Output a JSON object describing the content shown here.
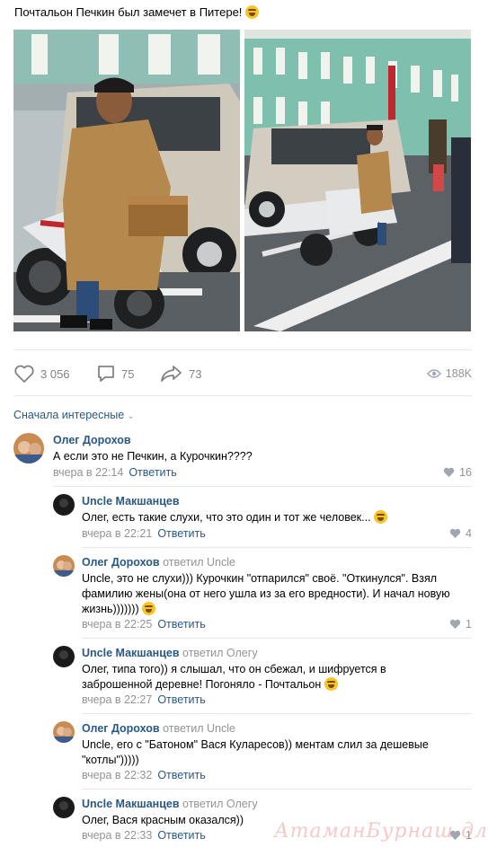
{
  "post": {
    "text": "Почтальон Печкин был замечет в Питере!",
    "emoji": "grinning-face-emoji"
  },
  "actions": {
    "likes": "3 056",
    "comments": "75",
    "shares": "73",
    "views": "188K"
  },
  "comments_sort": "Сначала интересные",
  "comments": [
    {
      "author": "Олег Дорохов",
      "replied_to": "",
      "text": "А если это не Печкин, а Курочкин????",
      "time": "вчера в 22:14",
      "reply_label": "Ответить",
      "likes": "16"
    },
    {
      "author": "Uncle Макшанцев",
      "replied_to": "",
      "text": "Олег, есть такие слухи, что это один и тот же человек...",
      "time": "вчера в 22:21",
      "reply_label": "Ответить",
      "likes": "4"
    },
    {
      "author": "Олег Дорохов",
      "replied_to": "ответил Uncle",
      "text": "Uncle, это не слухи))) Курочкин \"отпарился\" своё. \"Откинулся\". Взял фамилию жены(она от него ушла из за его вредности). И начал новую жизнь)))))))",
      "time": "вчера в 22:25",
      "reply_label": "Ответить",
      "likes": "1"
    },
    {
      "author": "Uncle Макшанцев",
      "replied_to": "ответил Олегу",
      "text": "Олег, типа того)) я слышал, что он сбежал, и шифруется в заброшенной деревне! Погоняло - Почтальон",
      "time": "вчера в 22:27",
      "reply_label": "Ответить",
      "likes": ""
    },
    {
      "author": "Олег Дорохов",
      "replied_to": "ответил Uncle",
      "text": "Uncle, его с \"Батоном\" Вася Куларесов)) ментам слил за дешевые \"котлы\")))))",
      "time": "вчера в 22:32",
      "reply_label": "Ответить",
      "likes": ""
    },
    {
      "author": "Uncle Макшанцев",
      "replied_to": "ответил Олегу",
      "text": "Олег, Вася красным оказался))",
      "time": "вчера в 22:33",
      "reply_label": "Ответить",
      "likes": "1"
    }
  ],
  "watermark": "АтаманБурнаш для ЯП",
  "colors": {
    "link": "#2a5885",
    "muted": "#939393",
    "divider": "#e7e8ec",
    "icon": "#828282"
  }
}
